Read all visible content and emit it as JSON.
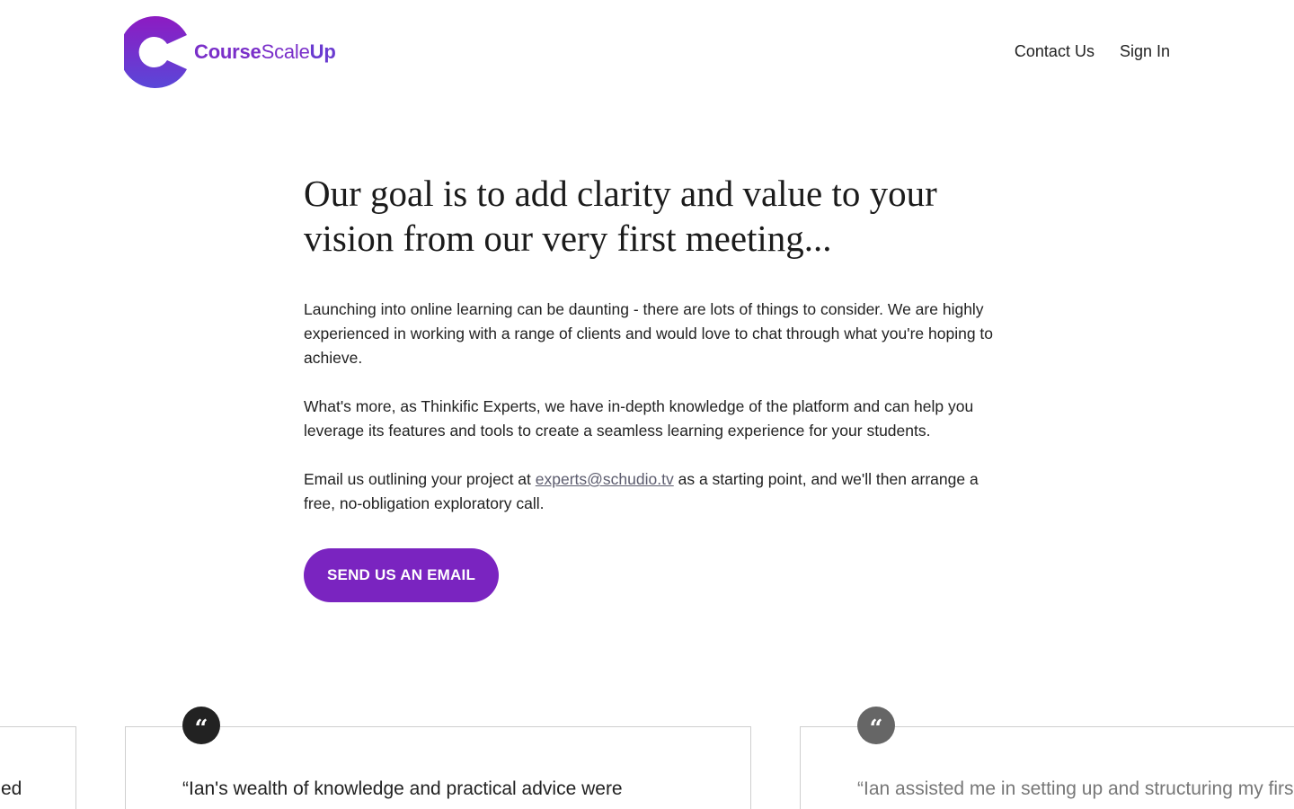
{
  "header": {
    "logo": {
      "part1": "Course",
      "part2": "Scale",
      "part3": "Up"
    },
    "nav": [
      {
        "label": "Contact Us"
      },
      {
        "label": "Sign In"
      }
    ]
  },
  "hero": {
    "title": "Our goal is to add clarity and value to your vision from our very first meeting...",
    "paragraph1": "Launching into online learning can be daunting - there are lots of things to consider. We are highly experienced in working with a range of clients and would love to chat through what you're hoping to achieve.",
    "paragraph2": "What's more, as Thinkific Experts, we have in-depth knowledge of the platform and can help you leverage its features and tools to create a seamless learning experience for your students.",
    "paragraph3_before": "Email us outlining your project at ",
    "email": "experts@schudio.tv",
    "paragraph3_after": " as a starting point, and we'll then arrange a free, no-obligation exploratory call.",
    "cta_label": "SEND US AN EMAIL"
  },
  "testimonials": {
    "quote_glyph": "“",
    "left_fragment": "ed",
    "center_text": "“Ian's wealth of knowledge and practical advice were",
    "right_text": "“Ian assisted me in setting up and structuring my firs"
  },
  "colors": {
    "brand_purple": "#7a24c0",
    "logo_gradient_top": "#8a1fc4",
    "logo_gradient_bottom": "#5b45d6"
  },
  "icons": {
    "logo": "c-logo-mark",
    "quote": "quote-icon"
  }
}
